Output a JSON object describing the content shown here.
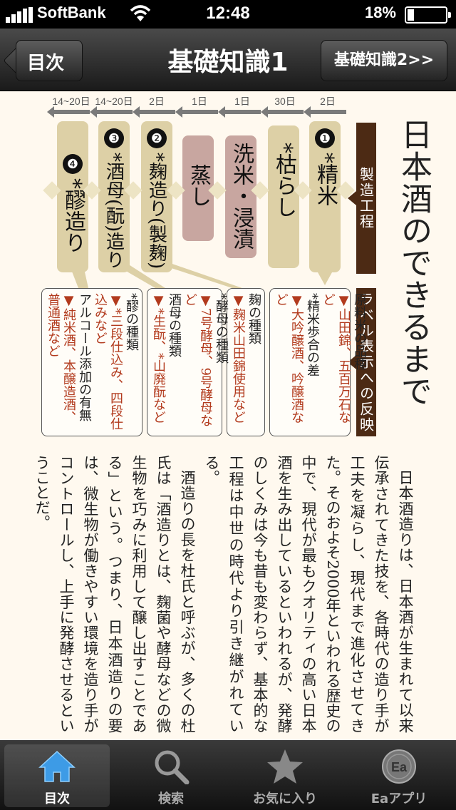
{
  "status": {
    "carrier": "SoftBank",
    "time": "12:48",
    "battery": "18%",
    "battery_level": 0.18
  },
  "nav": {
    "back_label": "目次",
    "title": "基礎知識1",
    "forward_label": "基礎知識2>>"
  },
  "headline": "日本酒のできるまで",
  "bands": {
    "process": "製造工程",
    "label": "ラベル表示への反映"
  },
  "durations": [
    "2日",
    "30日",
    "1日",
    "1日",
    "2日",
    "14~20日",
    "14~20日"
  ],
  "steps": [
    {
      "num": "❶",
      "text": "*精米"
    },
    {
      "num": "",
      "text": "*枯らし"
    },
    {
      "num": "",
      "text": "洗米・浸漬"
    },
    {
      "num": "",
      "text": "蒸し"
    },
    {
      "num": "❷",
      "text": "*麹造り(製麹)"
    },
    {
      "num": "❸",
      "text": "*酒母(酛)造り"
    },
    {
      "num": "❹",
      "text": "*醪造り"
    }
  ],
  "info": [
    {
      "lines": [
        {
          "t": "原料米の品種",
          "red": false
        },
        {
          "t": "▼山田錦、五百万石など",
          "red": true
        },
        {
          "t": "*精米歩合の差",
          "red": false
        },
        {
          "t": "▼大吟醸酒、吟醸酒など",
          "red": true
        }
      ]
    },
    {
      "lines": [
        {
          "t": "麹の種類",
          "red": false
        },
        {
          "t": "▼麹米山田錦使用など",
          "red": true
        }
      ]
    },
    {
      "lines": [
        {
          "t": "*酵母の種類",
          "red": false
        },
        {
          "t": "▼7号酵母、9号酵母など",
          "red": true
        },
        {
          "t": "酒母の種類",
          "red": false
        },
        {
          "t": "▼*生酛、*山廃酛など",
          "red": true
        }
      ]
    },
    {
      "lines": [
        {
          "t": "*醪の種類",
          "red": false
        },
        {
          "t": "▼*三段仕込み、四段仕込みなど",
          "red": true
        },
        {
          "t": "アルコール添加の有無",
          "red": false
        },
        {
          "t": "▼純米酒、本醸造酒、普通酒など",
          "red": true
        }
      ]
    }
  ],
  "body": [
    "日本酒造りは、日本酒が生まれて以来伝承されてきた技を、各時代の造り手が工夫を凝らし、現代まで進化させてきた。そのおよそ2000年といわれる歴史の中で、現代が最もクオリティの高い日本酒を生み出しているといわれるが、発酵のしくみは今も昔も変わらず、基本的な工程は中世の時代より引き継がれている。",
    "酒造りの長を杜氏と呼ぶが、多くの杜氏は「酒造りとは、麹菌や酵母などの微生物を巧みに利用して醸し出すことである」という。つまり、日本酒造りの要は、微生物が働きやすい環境を造り手がコントロールし、上手に発酵させるということだ。"
  ],
  "tabs": [
    {
      "label": "目次",
      "icon": "home-icon",
      "active": true
    },
    {
      "label": "検索",
      "icon": "search-icon",
      "active": false
    },
    {
      "label": "お気に入り",
      "icon": "star-icon",
      "active": false
    },
    {
      "label": "Eaアプリ",
      "icon": "ea-app-icon",
      "active": false
    }
  ],
  "colors": {
    "tan": "#ddd0a6",
    "pink": "#c8a6a0",
    "brown": "#4c2a14",
    "red": "#b23a1d"
  }
}
